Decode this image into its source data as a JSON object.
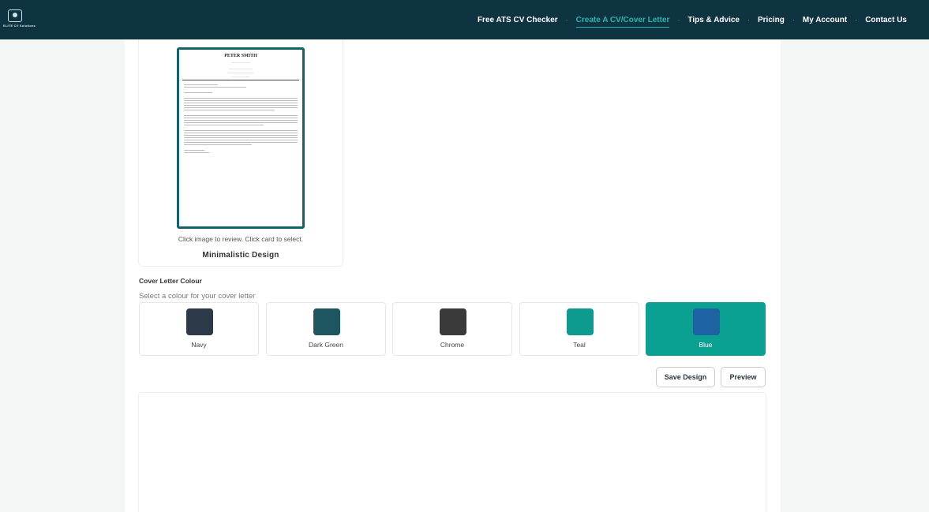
{
  "brand": {
    "logo_text": "ELITE CV Solutions"
  },
  "nav": {
    "items": [
      {
        "label": "Free ATS CV Checker",
        "active": false
      },
      {
        "label": "Create A CV/Cover Letter",
        "active": true
      },
      {
        "label": "Tips & Advice",
        "active": false
      },
      {
        "label": "Pricing",
        "active": false
      },
      {
        "label": "My Account",
        "active": false
      },
      {
        "label": "Contact Us",
        "active": false
      }
    ]
  },
  "template": {
    "preview_name": "PETER SMITH",
    "hint": "Click image to review. Click card to select.",
    "title": "Minimalistic Design"
  },
  "colour": {
    "label": "Cover Letter Colour",
    "subtitle": "Select a colour for your cover letter",
    "options": [
      {
        "name": "Navy",
        "hex": "#2c3a48",
        "selected": false
      },
      {
        "name": "Dark Green",
        "hex": "#1d5560",
        "selected": false
      },
      {
        "name": "Chrome",
        "hex": "#3a3a3a",
        "selected": false
      },
      {
        "name": "Teal",
        "hex": "#0d9a8f",
        "selected": false
      },
      {
        "name": "Blue",
        "hex": "#1d62a3",
        "selected": true
      }
    ]
  },
  "actions": {
    "save_label": "Save Design",
    "preview_label": "Preview"
  },
  "theme": {
    "topbar": "#0f3441",
    "accent": "#28b6b0",
    "selected_card": "#0aa193"
  }
}
